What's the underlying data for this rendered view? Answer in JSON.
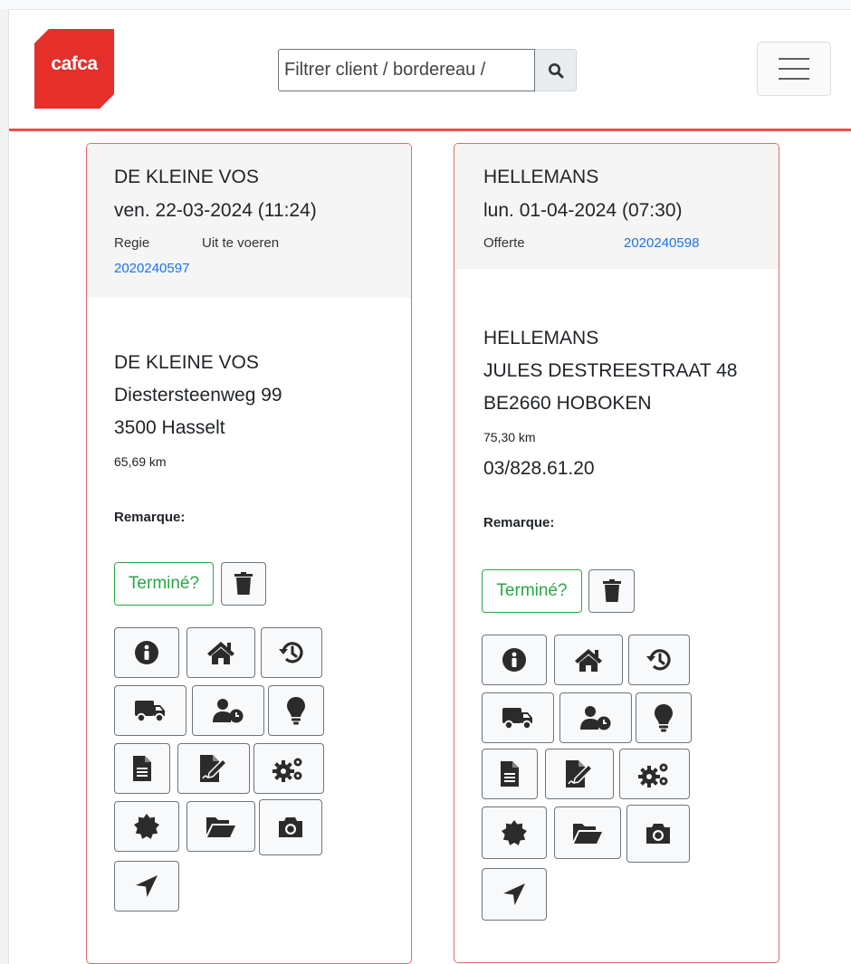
{
  "header": {
    "logo_text": "cafca",
    "search": {
      "placeholder": "Filtrer client / bordereau /",
      "icon": "search-icon"
    },
    "menu_icon": "hamburger-icon"
  },
  "colors": {
    "brand": "#e42f2b",
    "card_border": "#e36a6a",
    "success": "#28a745",
    "link": "#1a73e8"
  },
  "cards": [
    {
      "title": "DE KLEINE VOS",
      "date": "ven. 22-03-2024 (11:24)",
      "type": "Regie",
      "status": "Uit te voeren",
      "reference": "2020240597",
      "client_name": "DE KLEINE VOS",
      "address_line1": "Diestersteenweg 99",
      "address_line2": "3500 Hasselt",
      "distance": "65,69 km",
      "phone": "",
      "remark_label": "Remarque:",
      "done_label": "Terminé?"
    },
    {
      "title": "HELLEMANS",
      "date": "lun. 01-04-2024 (07:30)",
      "type": "Offerte",
      "status": "",
      "reference": "2020240598",
      "client_name": "HELLEMANS",
      "address_line1": "JULES DESTREESTRAAT 48",
      "address_line2": "BE2660 HOBOKEN",
      "distance": "75,30 km",
      "phone": "03/828.61.20",
      "remark_label": "Remarque:",
      "done_label": "Terminé?"
    }
  ],
  "action_icons": [
    "trash-icon",
    "info-icon",
    "home-icon",
    "history-icon",
    "truck-icon",
    "user-clock-icon",
    "lightbulb-icon",
    "document-icon",
    "signature-icon",
    "cogs-icon",
    "certificate-icon",
    "folder-open-icon",
    "camera-icon",
    "location-arrow-icon"
  ]
}
